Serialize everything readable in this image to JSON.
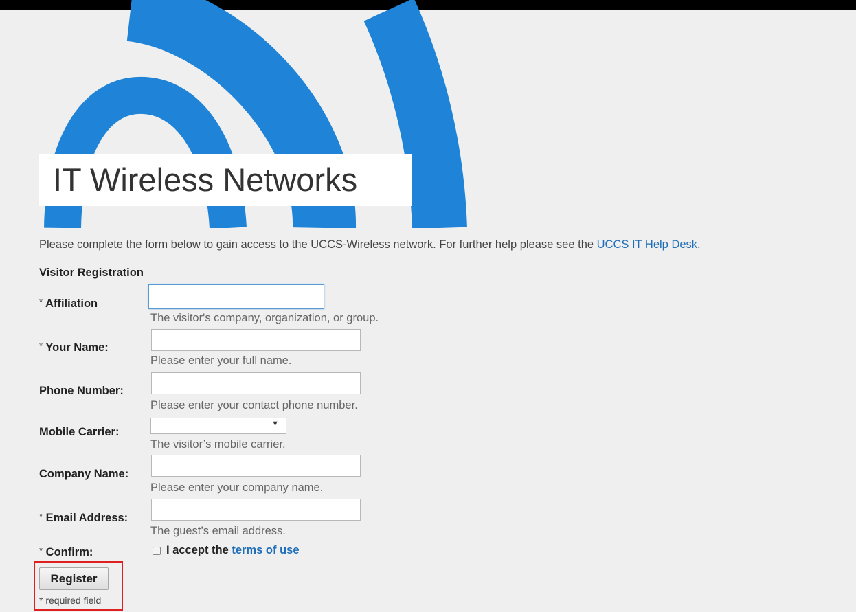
{
  "banner": {
    "title": "IT Wireless Networks",
    "accent_color": "#1f84d8",
    "icon": "wifi-signal-arcs"
  },
  "intro": {
    "text": "Please complete the form below to gain access to the UCCS-Wireless network. For further help please see the ",
    "link_text": "UCCS IT Help Desk",
    "trailing": "."
  },
  "form": {
    "section_title": "Visitor Registration",
    "required_mark": "*",
    "fields": [
      {
        "label": "Affiliation",
        "required": true,
        "value": "",
        "hint": "The visitor's company, organization, or group."
      },
      {
        "label": "Your Name:",
        "required": true,
        "value": "",
        "hint": "Please enter your full name."
      },
      {
        "label": "Phone Number:",
        "required": false,
        "value": "",
        "hint": "Please enter your contact phone number."
      },
      {
        "label": "Mobile Carrier:",
        "required": false,
        "value": "",
        "hint": "The visitor’s mobile carrier."
      },
      {
        "label": "Company Name:",
        "required": false,
        "value": "",
        "hint": "Please enter your company name."
      },
      {
        "label": "Email Address:",
        "required": true,
        "value": "",
        "hint": "The guest’s email address."
      }
    ],
    "confirm": {
      "label": "Confirm:",
      "required": true,
      "checked": false,
      "accept_text": "I accept the",
      "terms_link": "terms of use"
    },
    "register_label": "Register",
    "required_note": "required field",
    "highlight_color": "#e02020"
  }
}
